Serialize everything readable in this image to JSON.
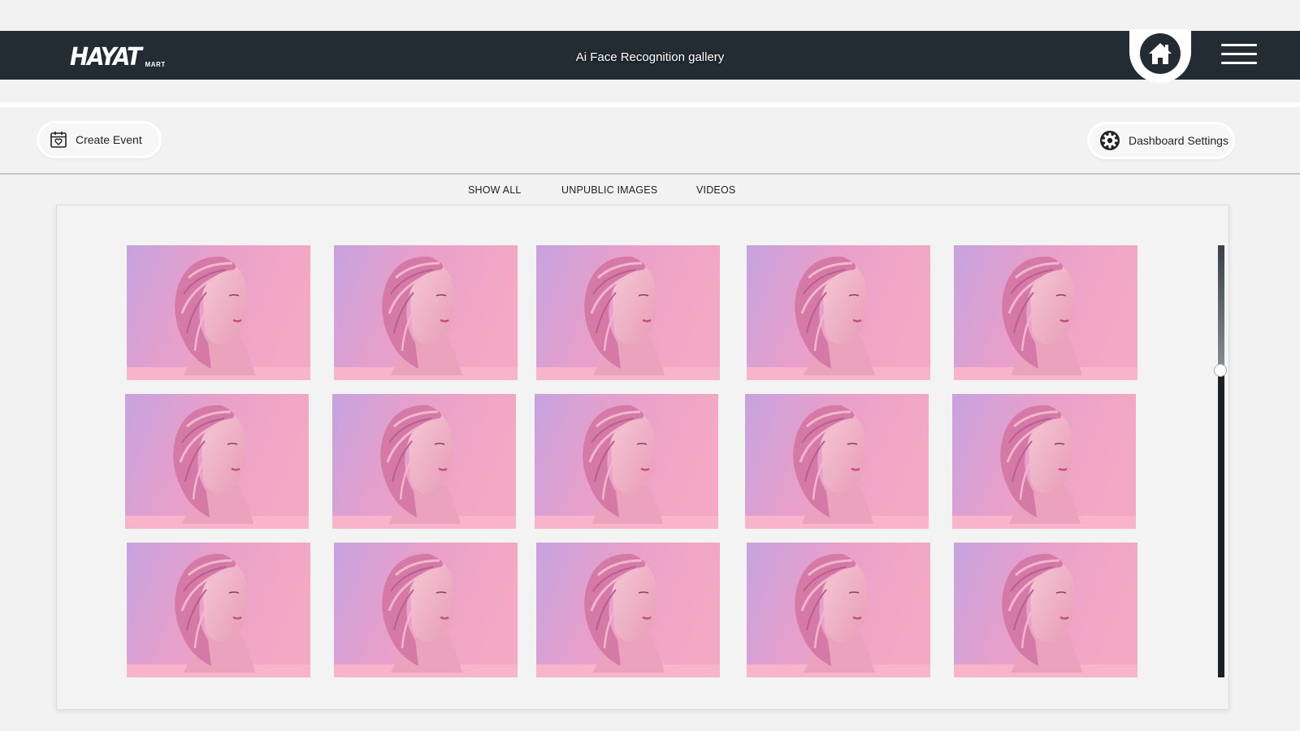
{
  "header": {
    "logo_main": "HAYAT",
    "logo_sub": "MART",
    "title": "Ai Face Recognition gallery",
    "home_icon": "home-icon",
    "menu_icon": "hamburger-menu-icon"
  },
  "toolbar": {
    "create_event_label": "Create Event",
    "create_event_icon": "calendar-heart-icon",
    "dashboard_settings_label": "Dashboard Settings",
    "dashboard_settings_icon": "gear-icon"
  },
  "filters": [
    "SHOW ALL",
    "UNPUBLIC IMAGES",
    "VIDEOS"
  ],
  "gallery": {
    "image_subject": "pink sculpted female bust",
    "rows": 3,
    "columns": 5
  },
  "colors": {
    "header_bg": "#232b33",
    "page_bg": "#f2f2f2",
    "thumb_pink": "#f3a6c4",
    "thumb_purple": "#c7a3de"
  }
}
